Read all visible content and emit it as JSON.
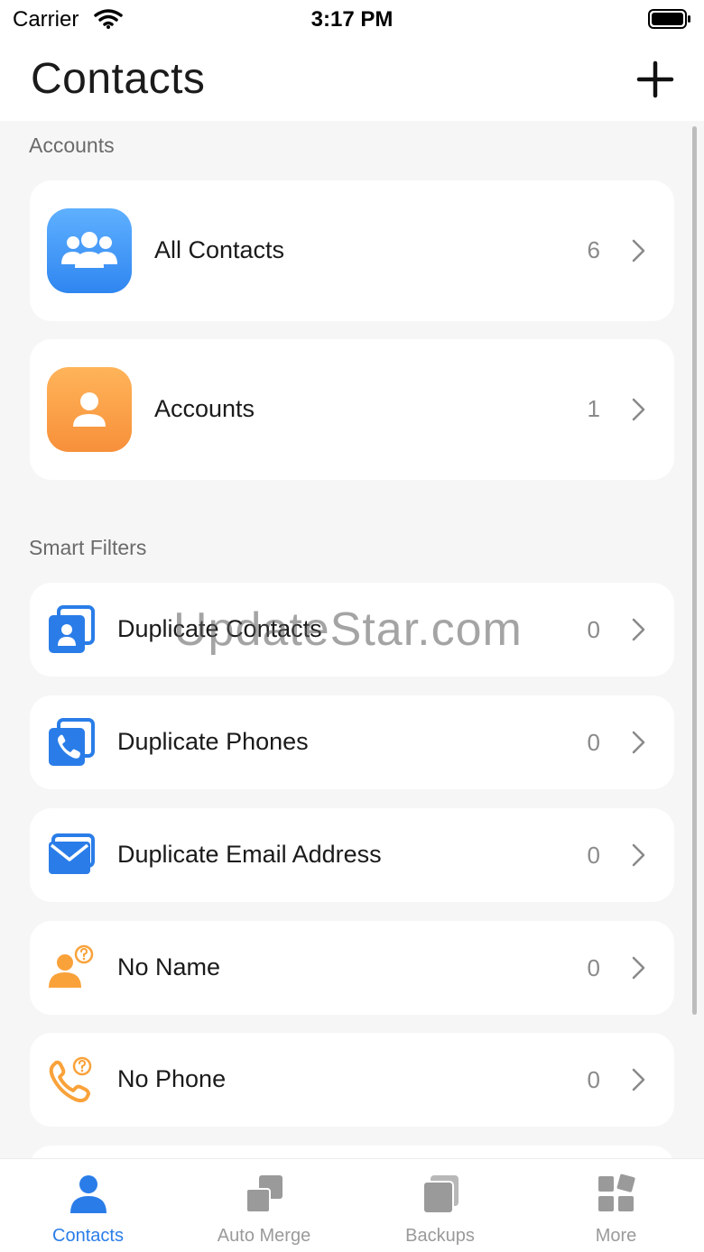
{
  "status_bar": {
    "carrier": "Carrier",
    "time": "3:17 PM"
  },
  "header": {
    "title": "Contacts",
    "add_icon": "plus-icon"
  },
  "sections": {
    "accounts_title": "Accounts",
    "smart_filters_title": "Smart Filters"
  },
  "accounts": [
    {
      "label": "All Contacts",
      "count": "6",
      "icon": "group-icon"
    },
    {
      "label": "Accounts",
      "count": "1",
      "icon": "person-icon"
    }
  ],
  "filters": [
    {
      "label": "Duplicate Contacts",
      "count": "0",
      "icon": "duplicate-contacts-icon"
    },
    {
      "label": "Duplicate Phones",
      "count": "0",
      "icon": "duplicate-phones-icon"
    },
    {
      "label": "Duplicate Email Address",
      "count": "0",
      "icon": "duplicate-email-icon"
    },
    {
      "label": "No Name",
      "count": "0",
      "icon": "no-name-icon"
    },
    {
      "label": "No Phone",
      "count": "0",
      "icon": "no-phone-icon"
    }
  ],
  "watermark": "UpdateStar.com",
  "tabbar": {
    "tabs": [
      {
        "label": "Contacts",
        "icon": "person-icon",
        "active": true
      },
      {
        "label": "Auto Merge",
        "icon": "merge-icon",
        "active": false
      },
      {
        "label": "Backups",
        "icon": "backups-icon",
        "active": false
      },
      {
        "label": "More",
        "icon": "grid-icon",
        "active": false
      }
    ]
  },
  "colors": {
    "accent_blue": "#2a7de8",
    "accent_orange": "#f9a23a",
    "inactive_gray": "#9a9a9a"
  }
}
